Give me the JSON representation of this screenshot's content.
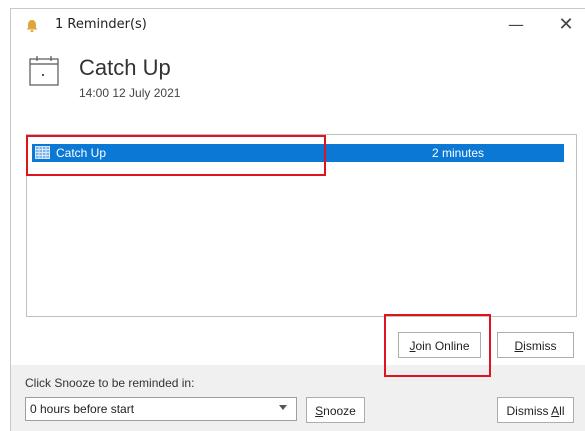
{
  "window": {
    "title": "1 Reminder(s)",
    "minimize_glyph": "—",
    "close_glyph": "✕"
  },
  "header": {
    "subject": "Catch Up",
    "datetime": "14:00 12 July 2021"
  },
  "reminders": [
    {
      "subject": "Catch Up",
      "due": "2 minutes",
      "icon": "calendar-grid-icon"
    }
  ],
  "actions": {
    "join_online_prefix": "",
    "join_online_mnemonic": "J",
    "join_online_rest": "oin Online",
    "dismiss_mnemonic": "D",
    "dismiss_rest": "ismiss"
  },
  "snooze": {
    "label": "Click Snooze to be reminded in:",
    "selected": "0 hours before start",
    "button_mnemonic": "S",
    "button_rest": "nooze",
    "dismiss_all_prefix": "Dismiss ",
    "dismiss_all_mnemonic": "A",
    "dismiss_all_rest": "ll"
  },
  "colors": {
    "selection": "#0a78d4",
    "highlight_box": "#e0141e",
    "bell": "#e0a63a"
  }
}
